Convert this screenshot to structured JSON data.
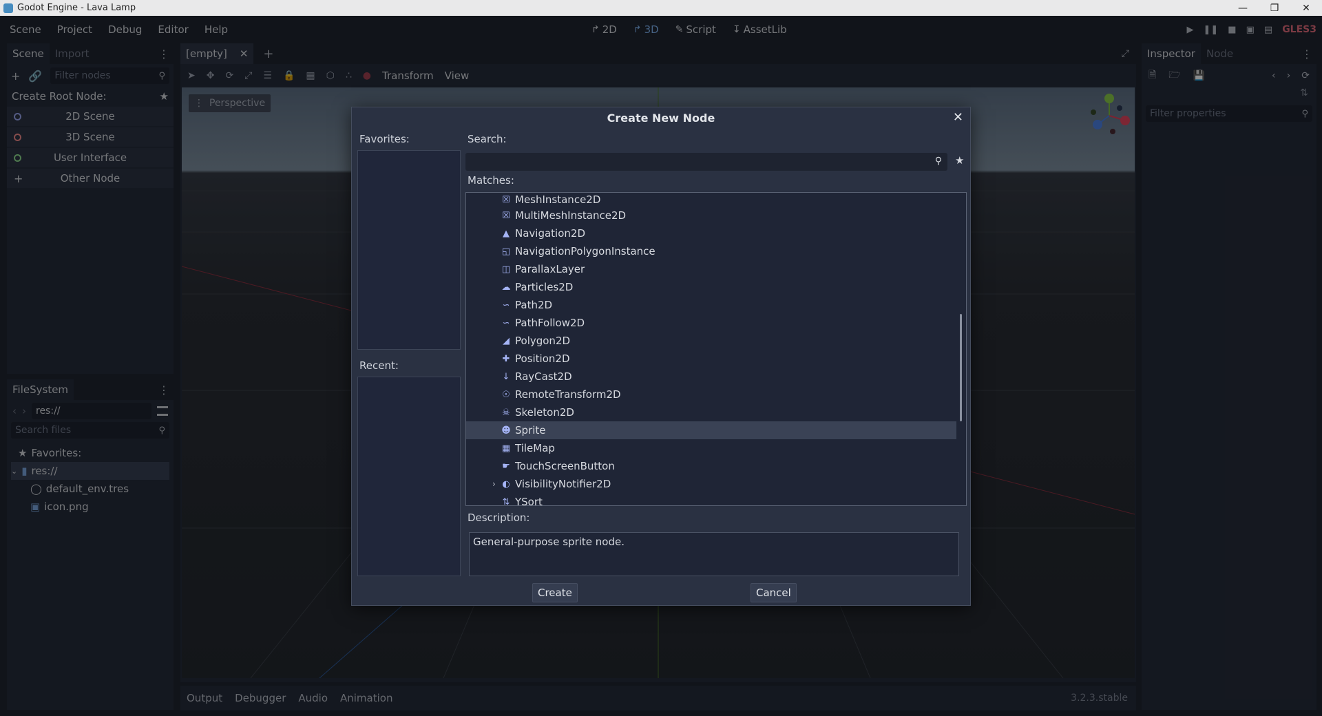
{
  "window": {
    "title": "Godot Engine - Lava Lamp"
  },
  "menu": [
    "Scene",
    "Project",
    "Debug",
    "Editor",
    "Help"
  ],
  "main_screens": [
    {
      "label": "2D",
      "icon": "2d-icon",
      "active": false
    },
    {
      "label": "3D",
      "icon": "3d-icon",
      "active": true
    },
    {
      "label": "Script",
      "icon": "script-icon",
      "active": false
    },
    {
      "label": "AssetLib",
      "icon": "assetlib-icon",
      "active": false
    }
  ],
  "renderer": "GLES3",
  "scene_dock": {
    "tabs": [
      "Scene",
      "Import"
    ],
    "filter_placeholder": "Filter nodes",
    "root_header": "Create Root Node:",
    "root_buttons": [
      "2D Scene",
      "3D Scene",
      "User Interface",
      "Other Node"
    ]
  },
  "filesystem_dock": {
    "tab": "FileSystem",
    "path": "res://",
    "search_placeholder": "Search files",
    "tree": [
      "Favorites:",
      "res://",
      "default_env.tres",
      "icon.png"
    ]
  },
  "viewport": {
    "scene_tab": "[empty]",
    "menus": [
      "Transform",
      "View"
    ],
    "perspective_label": "Perspective"
  },
  "bottom_panel": {
    "tabs": [
      "Output",
      "Debugger",
      "Audio",
      "Animation"
    ],
    "version": "3.2.3.stable"
  },
  "inspector": {
    "tabs": [
      "Inspector",
      "Node"
    ],
    "filter_placeholder": "Filter properties"
  },
  "dialog": {
    "title": "Create New Node",
    "favorites_label": "Favorites:",
    "recent_label": "Recent:",
    "search_label": "Search:",
    "matches_label": "Matches:",
    "matches": [
      {
        "label": "MeshInstance2D",
        "icon": "mesh-icon"
      },
      {
        "label": "MultiMeshInstance2D",
        "icon": "multimesh-icon"
      },
      {
        "label": "Navigation2D",
        "icon": "navigation-icon"
      },
      {
        "label": "NavigationPolygonInstance",
        "icon": "navpoly-icon"
      },
      {
        "label": "ParallaxLayer",
        "icon": "parallax-icon"
      },
      {
        "label": "Particles2D",
        "icon": "particles-icon"
      },
      {
        "label": "Path2D",
        "icon": "path-icon"
      },
      {
        "label": "PathFollow2D",
        "icon": "pathfollow-icon"
      },
      {
        "label": "Polygon2D",
        "icon": "polygon-icon"
      },
      {
        "label": "Position2D",
        "icon": "position-icon"
      },
      {
        "label": "RayCast2D",
        "icon": "raycast-icon"
      },
      {
        "label": "RemoteTransform2D",
        "icon": "remote-transform-icon"
      },
      {
        "label": "Skeleton2D",
        "icon": "skeleton-icon"
      },
      {
        "label": "Sprite",
        "icon": "sprite-icon",
        "selected": true
      },
      {
        "label": "TileMap",
        "icon": "tilemap-icon"
      },
      {
        "label": "TouchScreenButton",
        "icon": "touch-button-icon"
      },
      {
        "label": "VisibilityNotifier2D",
        "icon": "visibility-icon",
        "expandable": true
      },
      {
        "label": "YSort",
        "icon": "ysort-icon"
      }
    ],
    "description_label": "Description:",
    "description": "General-purpose sprite node.",
    "create_label": "Create",
    "cancel_label": "Cancel"
  }
}
